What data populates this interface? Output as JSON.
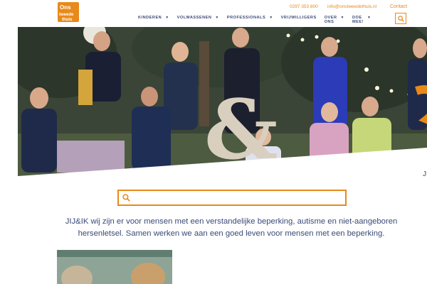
{
  "header": {
    "logo_text": "Ons tweede thuis",
    "phone": "0297 353 800",
    "email": "info@onstweedethuis.nl",
    "contact_label": "Contact"
  },
  "nav": {
    "items": [
      {
        "label": "KINDEREN",
        "has_dropdown": true
      },
      {
        "label": "VOLWASSENEN",
        "has_dropdown": true
      },
      {
        "label": "PROFESSIONALS",
        "has_dropdown": true
      },
      {
        "label": "VRIJWILLIGERS",
        "has_dropdown": false
      },
      {
        "label_line1": "OVER",
        "label_line2": "ONS",
        "has_dropdown": true
      },
      {
        "label_line1": "DOE",
        "label_line2": "MEE!",
        "has_dropdown": true
      }
    ],
    "search_icon": "search-icon"
  },
  "hero": {
    "alt_description": "",
    "decor_sign": "&",
    "right_text": "JI"
  },
  "search": {
    "placeholder": "",
    "value": ""
  },
  "intro": {
    "text": "JIJ&IK wij zijn er voor mensen met een verstandelijke beperking, autisme en niet-aangeboren hersenletsel. Samen werken we aan een goed leven voor mensen met een beperking."
  },
  "colors": {
    "accent": "#e8891a",
    "text": "#3b4a78"
  }
}
